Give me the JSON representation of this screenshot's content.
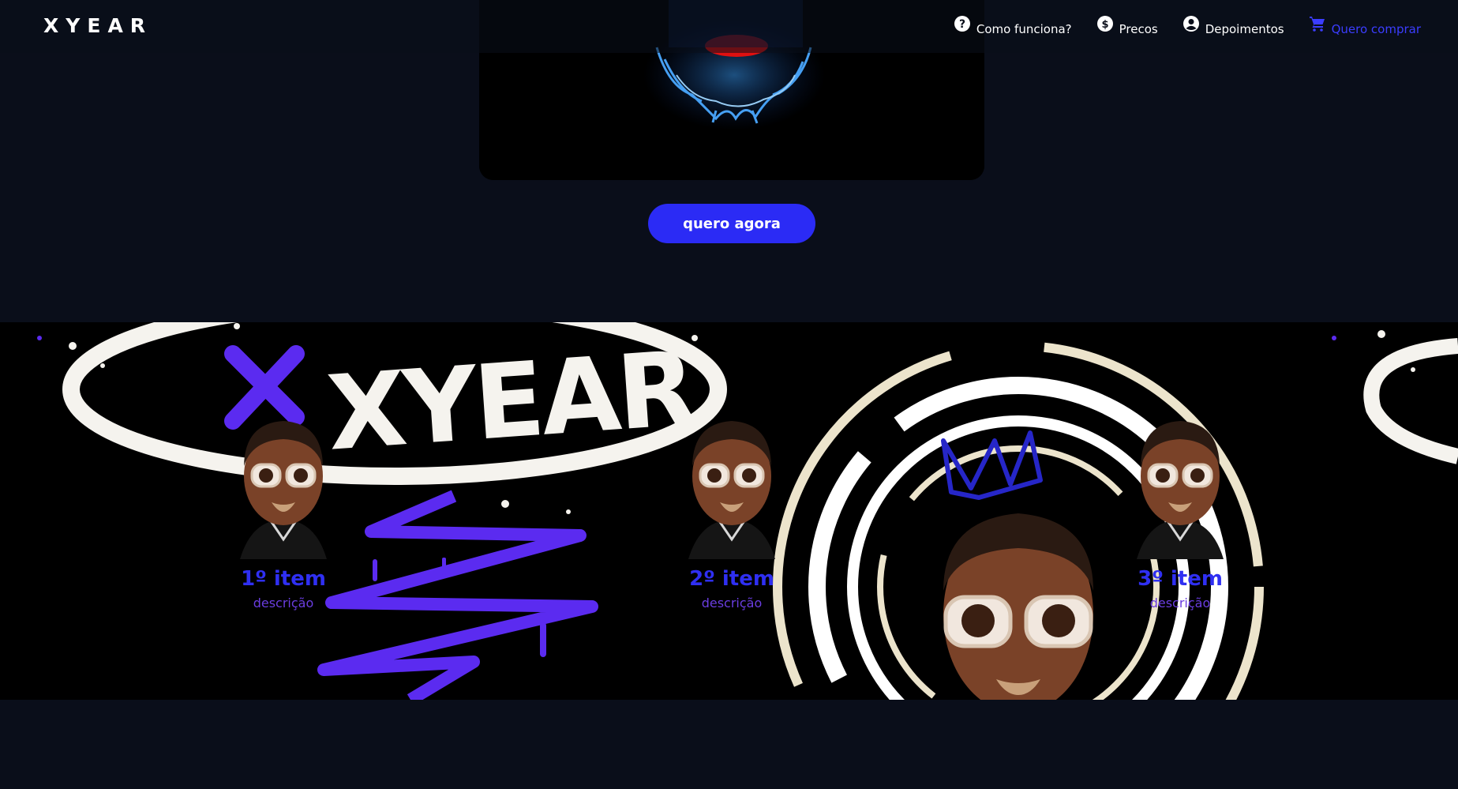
{
  "header": {
    "logo": "XYEAR",
    "nav": [
      {
        "label": "Como funciona?",
        "icon": "help-circle-icon"
      },
      {
        "label": "Precos",
        "icon": "dollar-circle-icon"
      },
      {
        "label": "Depoimentos",
        "icon": "account-circle-icon"
      },
      {
        "label": "Quero comprar",
        "icon": "shopping-cart-icon"
      }
    ]
  },
  "hero": {
    "cta_label": "quero agora"
  },
  "steps": {
    "banner_text": "XYEAR",
    "items": [
      {
        "title": "1º item",
        "description": "descrição"
      },
      {
        "title": "2º item",
        "description": "descrição"
      },
      {
        "title": "3º item",
        "description": "descrição"
      }
    ]
  },
  "colors": {
    "background": "#0a0e1a",
    "accent_blue": "#2b2bf5",
    "step_title": "#2f2ff2",
    "step_description": "#6a3de0",
    "scribble_purple": "#5b2bf0"
  }
}
